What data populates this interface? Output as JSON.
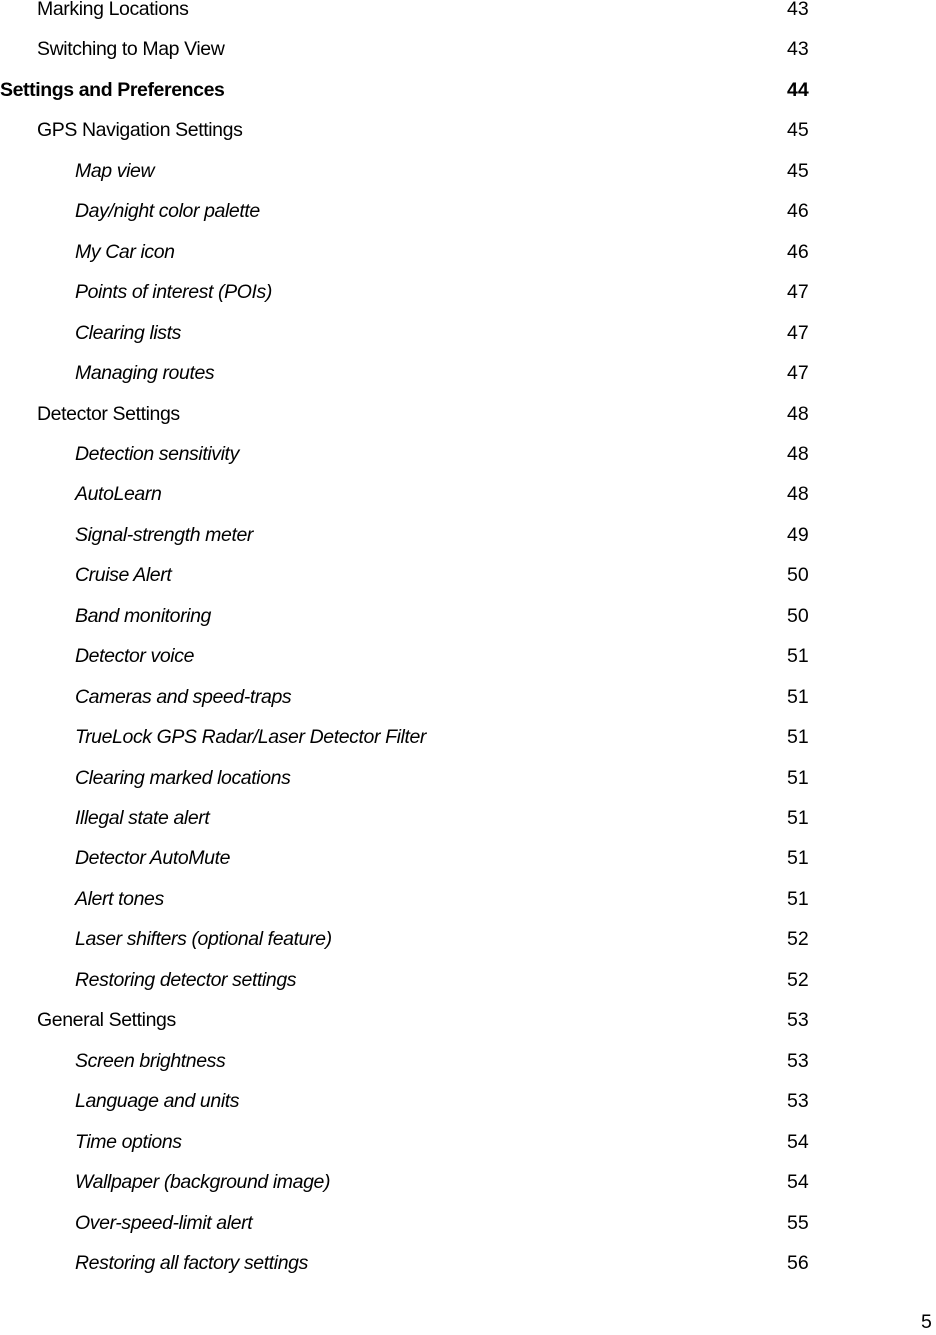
{
  "toc": [
    {
      "label": "Marking Locations",
      "page": "43",
      "level": 2
    },
    {
      "label": "Switching to Map View",
      "page": "43",
      "level": 2
    },
    {
      "label": "Settings and Preferences",
      "page": "44",
      "level": 1
    },
    {
      "label": "GPS Navigation Settings",
      "page": "45",
      "level": 2
    },
    {
      "label": "Map view",
      "page": "45",
      "level": 3
    },
    {
      "label": "Day/night color palette",
      "page": "46",
      "level": 3
    },
    {
      "label": "My Car icon",
      "page": "46",
      "level": 3
    },
    {
      "label": "Points of interest (POIs)",
      "page": "47",
      "level": 3
    },
    {
      "label": "Clearing lists",
      "page": "47",
      "level": 3
    },
    {
      "label": "Managing routes",
      "page": "47",
      "level": 3
    },
    {
      "label": "Detector Settings",
      "page": "48",
      "level": 2
    },
    {
      "label": "Detection sensitivity",
      "page": "48",
      "level": 3
    },
    {
      "label": "AutoLearn",
      "page": "48",
      "level": 3
    },
    {
      "label": "Signal-strength meter",
      "page": "49",
      "level": 3
    },
    {
      "label": "Cruise Alert",
      "page": "50",
      "level": 3
    },
    {
      "label": "Band monitoring",
      "page": "50",
      "level": 3
    },
    {
      "label": "Detector voice",
      "page": "51",
      "level": 3
    },
    {
      "label": "Cameras and speed-traps",
      "page": "51",
      "level": 3
    },
    {
      "label": "TrueLock GPS Radar/Laser Detector Filter",
      "page": "51",
      "level": 3
    },
    {
      "label": "Clearing marked locations",
      "page": "51",
      "level": 3
    },
    {
      "label": "Illegal state alert",
      "page": "51",
      "level": 3
    },
    {
      "label": "Detector AutoMute",
      "page": "51",
      "level": 3
    },
    {
      "label": "Alert tones",
      "page": "51",
      "level": 3
    },
    {
      "label": "Laser shifters (optional feature)",
      "page": "52",
      "level": 3
    },
    {
      "label": "Restoring detector settings",
      "page": "52",
      "level": 3
    },
    {
      "label": "General Settings",
      "page": "53",
      "level": 2
    },
    {
      "label": "Screen brightness",
      "page": "53",
      "level": 3
    },
    {
      "label": "Language and units",
      "page": "53",
      "level": 3
    },
    {
      "label": "Time options",
      "page": "54",
      "level": 3
    },
    {
      "label": "Wallpaper (background image)",
      "page": "54",
      "level": 3
    },
    {
      "label": "Over-speed-limit alert",
      "page": "55",
      "level": 3
    },
    {
      "label": "Restoring all factory settings",
      "page": "56",
      "level": 3
    }
  ],
  "footer": {
    "page_number": "5"
  }
}
